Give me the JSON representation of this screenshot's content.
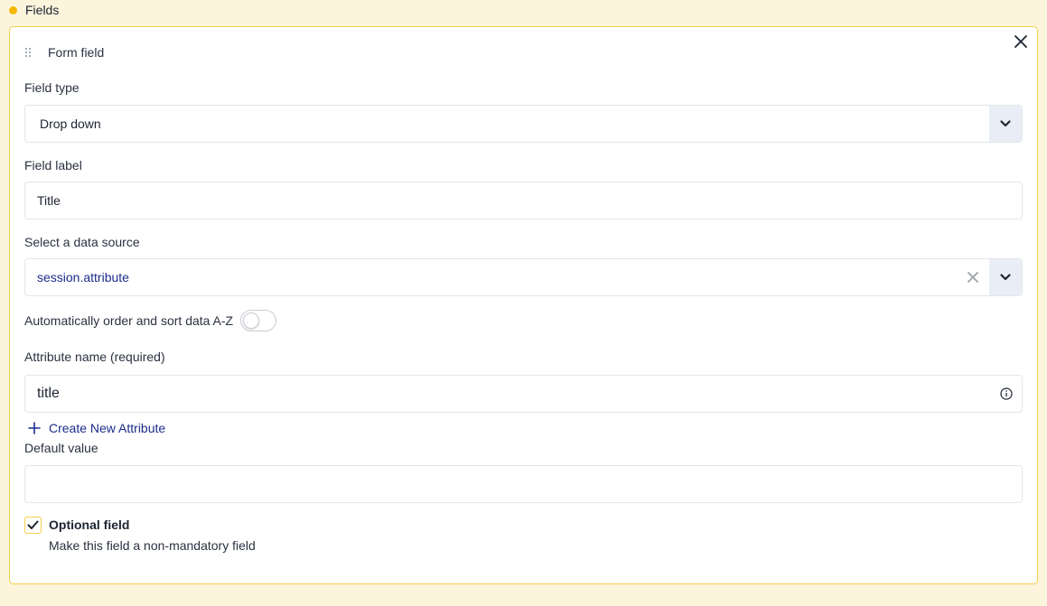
{
  "section": {
    "title": "Fields",
    "dot_color": "#f5b800"
  },
  "card": {
    "title": "Form field",
    "field_type": {
      "label": "Field type",
      "value": "Drop down"
    },
    "field_label": {
      "label": "Field label",
      "value": "Title"
    },
    "data_source": {
      "label": "Select a data source",
      "value": "session.attribute"
    },
    "auto_sort": {
      "label": "Automatically order and sort data A-Z",
      "enabled": false
    },
    "attribute_name": {
      "label": "Attribute name (required)",
      "value": "title"
    },
    "create_attribute": {
      "label": "Create New Attribute"
    },
    "default_value": {
      "label": "Default value",
      "value": "",
      "placeholder": ""
    },
    "optional": {
      "title": "Optional field",
      "description": "Make this field a non-mandatory field",
      "checked": true
    }
  },
  "colors": {
    "accent": "#f2cf4a",
    "link": "#1b2c8a",
    "background": "#fdf4dc"
  },
  "icons": [
    "drag-handle-icon",
    "close-icon",
    "chevron-down-icon",
    "clear-icon",
    "info-icon",
    "plus-icon",
    "checkmark-icon"
  ]
}
